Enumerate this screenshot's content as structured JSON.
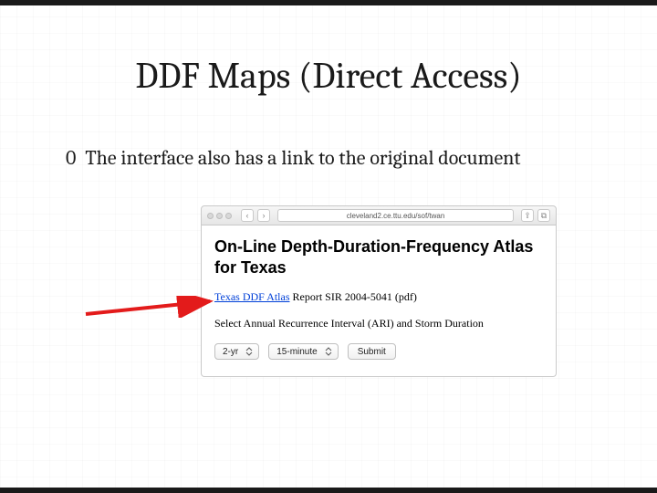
{
  "slide": {
    "title": "DDF Maps (Direct Access)",
    "bullet_marker": "0",
    "bullet_text": "The interface also has a link to the original document"
  },
  "browser": {
    "address": "cleveland2.ce.ttu.edu/sof/twan",
    "nav_back": "‹",
    "nav_fwd": "›",
    "page": {
      "heading": "On-Line Depth-Duration-Frequency Atlas for Texas",
      "link_text": "Texas DDF Atlas",
      "link_suffix": " Report SIR 2004-5041 (pdf)",
      "select_prompt": "Select Annual Recurrence Interval (ARI) and Storm Duration",
      "ari_selected": "2-yr",
      "duration_selected": "15-minute",
      "submit_label": "Submit"
    }
  },
  "arrow_color": "#e31b1b"
}
